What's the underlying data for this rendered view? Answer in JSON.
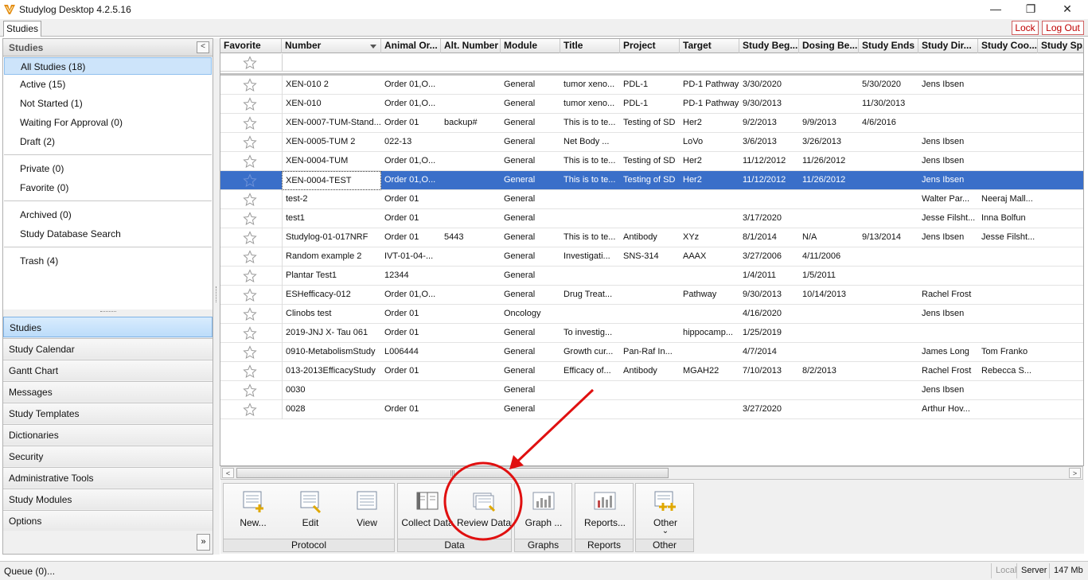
{
  "window": {
    "title": "Studylog Desktop 4.2.5.16",
    "minimize": "—",
    "restore": "❐",
    "close": "✕"
  },
  "top_tabs": {
    "studies": "Studies"
  },
  "top_actions": {
    "lock": "Lock",
    "logout": "Log Out"
  },
  "sidebar": {
    "title": "Studies",
    "collapse": "<",
    "filters": [
      {
        "label": "All Studies (18)",
        "selected": true
      },
      {
        "label": "Active (15)"
      },
      {
        "label": "Not Started (1)"
      },
      {
        "label": "Waiting For Approval (0)"
      },
      {
        "label": "Draft (2)"
      },
      {
        "label": "Private (0)"
      },
      {
        "label": "Favorite (0)"
      },
      {
        "label": "Archived (0)"
      },
      {
        "label": "Study Database Search"
      },
      {
        "label": "Trash (4)"
      }
    ],
    "nav": [
      {
        "label": "Studies",
        "selected": true
      },
      {
        "label": "Study Calendar"
      },
      {
        "label": "Gantt Chart"
      },
      {
        "label": "Messages"
      },
      {
        "label": "Study Templates"
      },
      {
        "label": "Dictionaries"
      },
      {
        "label": "Security"
      },
      {
        "label": "Administrative Tools"
      },
      {
        "label": "Study Modules"
      },
      {
        "label": "Options"
      }
    ],
    "more": "»"
  },
  "grid": {
    "columns": [
      "Favorite",
      "Number",
      "Animal Or...",
      "Alt. Number",
      "Module",
      "Title",
      "Project",
      "Target",
      "Study Beg...",
      "Dosing Be...",
      "Study Ends",
      "Study Dir...",
      "Study Coo...",
      "Study Sp..."
    ],
    "rows": [
      [
        "XEN-010 2",
        "Order 01,O...",
        "",
        "General",
        "tumor xeno...",
        "PDL-1",
        "PD-1 Pathway",
        "3/30/2020",
        "",
        "5/30/2020",
        "Jens Ibsen",
        "",
        ""
      ],
      [
        "XEN-010",
        "Order 01,O...",
        "",
        "General",
        "tumor xeno...",
        "PDL-1",
        "PD-1 Pathway",
        "9/30/2013",
        "",
        "11/30/2013",
        "",
        "",
        ""
      ],
      [
        "XEN-0007-TUM-Stand...",
        "Order 01",
        "backup#",
        "General",
        "This is to te...",
        "Testing of SD",
        "Her2",
        "9/2/2013",
        "9/9/2013",
        "4/6/2016",
        "",
        "",
        ""
      ],
      [
        "XEN-0005-TUM 2",
        "022-13",
        "",
        "General",
        "Net Body ...",
        "",
        "LoVo",
        "3/6/2013",
        "3/26/2013",
        "",
        "Jens Ibsen",
        "",
        ""
      ],
      [
        "XEN-0004-TUM",
        "Order 01,O...",
        "",
        "General",
        "This is to te...",
        "Testing of SD",
        "Her2",
        "11/12/2012",
        "11/26/2012",
        "",
        "Jens Ibsen",
        "",
        ""
      ],
      [
        "XEN-0004-TEST",
        "Order 01,O...",
        "",
        "General",
        "This is to te...",
        "Testing of SD",
        "Her2",
        "11/12/2012",
        "11/26/2012",
        "",
        "Jens Ibsen",
        "",
        ""
      ],
      [
        "test-2",
        "Order 01",
        "",
        "General",
        "",
        "",
        "",
        "",
        "",
        "",
        "Walter Par...",
        "Neeraj Mall...",
        ""
      ],
      [
        "test1",
        "Order 01",
        "",
        "General",
        "",
        "",
        "",
        "3/17/2020",
        "",
        "",
        "Jesse Filsht...",
        "Inna Bolfun",
        ""
      ],
      [
        "Studylog-01-017NRF",
        "Order 01",
        "5443",
        "General",
        "This is to te...",
        "Antibody",
        "XYz",
        "8/1/2014",
        "N/A",
        "9/13/2014",
        "Jens Ibsen",
        "Jesse Filsht...",
        ""
      ],
      [
        "Random example 2",
        "IVT-01-04-...",
        "",
        "General",
        "Investigati...",
        "SNS-314",
        "AAAX",
        "3/27/2006",
        "4/11/2006",
        "",
        "",
        "",
        ""
      ],
      [
        "Plantar Test1",
        "12344",
        "",
        "General",
        "",
        "",
        "",
        "1/4/2011",
        "1/5/2011",
        "",
        "",
        "",
        ""
      ],
      [
        "ESHefficacy-012",
        "Order 01,O...",
        "",
        "General",
        "Drug Treat...",
        "",
        "Pathway",
        "9/30/2013",
        "10/14/2013",
        "",
        "Rachel Frost",
        "",
        ""
      ],
      [
        "Clinobs test",
        "Order 01",
        "",
        "Oncology",
        "",
        "",
        "",
        "4/16/2020",
        "",
        "",
        "Jens Ibsen",
        "",
        ""
      ],
      [
        "2019-JNJ X- Tau 061",
        "Order 01",
        "",
        "General",
        "To investig...",
        "",
        "hippocamp...",
        "1/25/2019",
        "",
        "",
        "",
        "",
        ""
      ],
      [
        "0910-MetabolismStudy",
        "L006444",
        "",
        "General",
        "Growth cur...",
        "Pan-Raf In...",
        "",
        "4/7/2014",
        "",
        "",
        "James Long",
        "Tom Franko",
        ""
      ],
      [
        "013-2013EfficacyStudy",
        "Order 01",
        "",
        "General",
        " Efficacy of...",
        "Antibody",
        "MGAH22",
        "7/10/2013",
        "8/2/2013",
        "",
        "Rachel Frost",
        "Rebecca S...",
        ""
      ],
      [
        "0030",
        "",
        "",
        "General",
        "",
        "",
        "",
        "",
        "",
        "",
        "Jens Ibsen",
        "",
        ""
      ],
      [
        "0028",
        "Order 01",
        "",
        "General",
        "",
        "",
        "",
        "3/27/2020",
        "",
        "",
        "Arthur Hov...",
        "",
        ""
      ]
    ],
    "selected_row": 5
  },
  "scrollbar": {
    "left": "<",
    "right": ">",
    "thumb": "|||"
  },
  "ribbon": {
    "groups": [
      {
        "label": "Protocol",
        "buttons": [
          {
            "label": "New...",
            "icon": "new-doc-icon"
          },
          {
            "label": "Edit",
            "icon": "edit-doc-icon"
          },
          {
            "label": "View",
            "icon": "view-doc-icon"
          }
        ]
      },
      {
        "label": "Data",
        "buttons": [
          {
            "label": "Collect Data",
            "icon": "collect-data-icon"
          },
          {
            "label": "Review Data",
            "icon": "review-data-icon"
          }
        ]
      },
      {
        "label": "Graphs",
        "buttons": [
          {
            "label": "Graph ...",
            "icon": "graph-icon"
          }
        ]
      },
      {
        "label": "Reports",
        "buttons": [
          {
            "label": "Reports...",
            "icon": "reports-icon"
          }
        ]
      },
      {
        "label": "Other",
        "buttons": [
          {
            "label": "Other",
            "icon": "other-icon",
            "sub": "⌄"
          }
        ]
      }
    ]
  },
  "status": {
    "queue": "Queue (0)...",
    "local": "Local",
    "server": "Server",
    "memory": "147 Mb"
  },
  "colors": {
    "selection": "#3a6fc9",
    "annotation": "#e01010",
    "accent": "#c00000"
  }
}
